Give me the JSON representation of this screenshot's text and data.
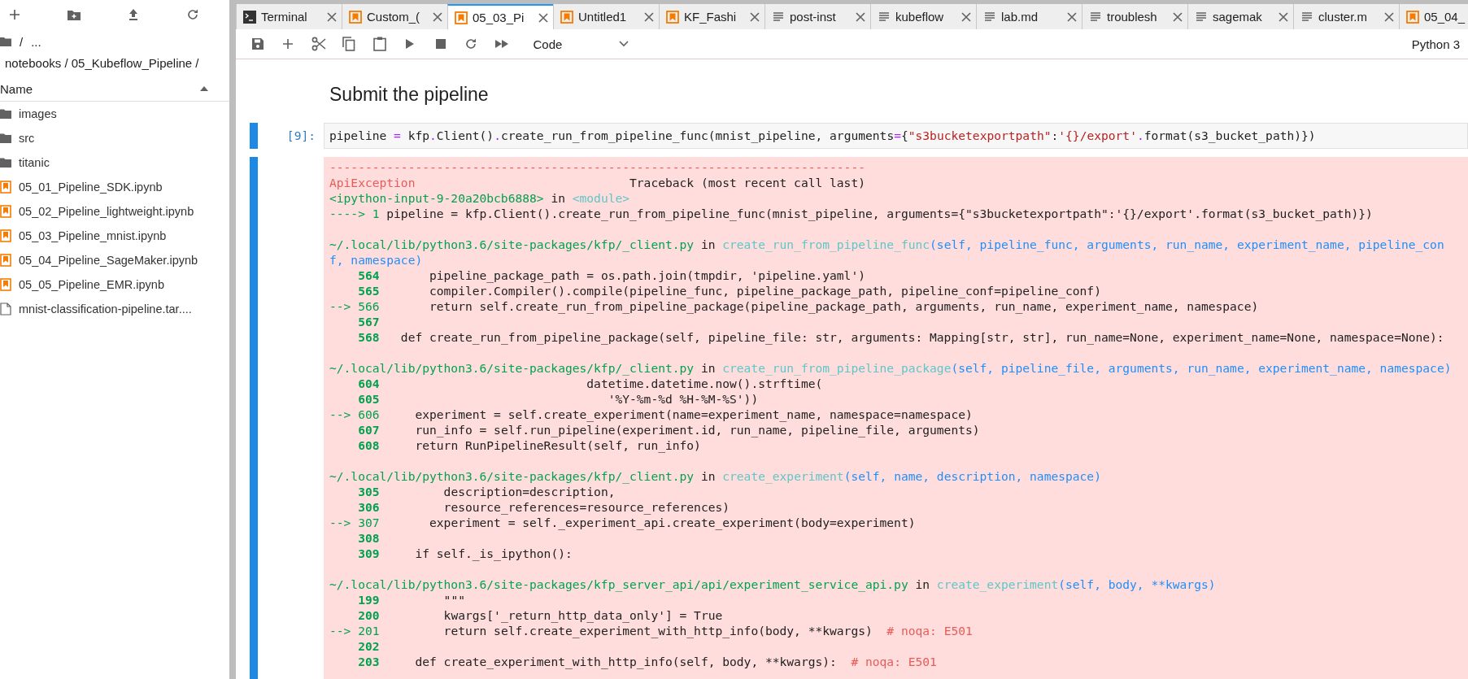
{
  "file_browser": {
    "breadcrumbs": [
      "/",
      "..."
    ],
    "path": "notebooks / 05_Kubeflow_Pipeline /",
    "column_header": "Name",
    "items": [
      {
        "name": "images",
        "kind": "folder"
      },
      {
        "name": "src",
        "kind": "folder"
      },
      {
        "name": "titanic",
        "kind": "folder"
      },
      {
        "name": "05_01_Pipeline_SDK.ipynb",
        "kind": "notebook"
      },
      {
        "name": "05_02_Pipeline_lightweight.ipynb",
        "kind": "notebook"
      },
      {
        "name": "05_03_Pipeline_mnist.ipynb",
        "kind": "notebook"
      },
      {
        "name": "05_04_Pipeline_SageMaker.ipynb",
        "kind": "notebook"
      },
      {
        "name": "05_05_Pipeline_EMR.ipynb",
        "kind": "notebook"
      },
      {
        "name": "mnist-classification-pipeline.tar....",
        "kind": "file"
      }
    ]
  },
  "tabs": [
    {
      "label": "Terminal",
      "kind": "terminal",
      "selected": false
    },
    {
      "label": "Custom_(",
      "kind": "notebook",
      "selected": false
    },
    {
      "label": "05_03_Pi",
      "kind": "notebook",
      "selected": true
    },
    {
      "label": "Untitled1",
      "kind": "notebook",
      "selected": false
    },
    {
      "label": "KF_Fashi",
      "kind": "notebook",
      "selected": false
    },
    {
      "label": "post-inst",
      "kind": "text",
      "selected": false
    },
    {
      "label": "kubeflow",
      "kind": "text",
      "selected": false
    },
    {
      "label": "lab.md",
      "kind": "text",
      "selected": false
    },
    {
      "label": "troublesh",
      "kind": "text",
      "selected": false
    },
    {
      "label": "sagemak",
      "kind": "text",
      "selected": false
    },
    {
      "label": "cluster.m",
      "kind": "text",
      "selected": false
    },
    {
      "label": "05_04_",
      "kind": "notebook",
      "selected": false
    }
  ],
  "notebook_toolbar": {
    "cell_type": "Code",
    "kernel": "Python 3"
  },
  "cells": [
    {
      "kind": "markdown",
      "heading": "Submit the pipeline"
    },
    {
      "kind": "code",
      "prompt": "[9]:",
      "source": [
        {
          "text": "pipeline ",
          "kind": "plain"
        },
        {
          "text": "=",
          "kind": "op"
        },
        {
          "text": " kfp",
          "kind": "plain"
        },
        {
          "text": ".",
          "kind": "op"
        },
        {
          "text": "Client()",
          "kind": "plain"
        },
        {
          "text": ".",
          "kind": "op"
        },
        {
          "text": "create_run_from_pipeline_func(mnist_pipeline, arguments",
          "kind": "plain"
        },
        {
          "text": "=",
          "kind": "op"
        },
        {
          "text": "{",
          "kind": "plain"
        },
        {
          "text": "\"s3bucketexportpath\"",
          "kind": "literal"
        },
        {
          "text": ":",
          "kind": "plain"
        },
        {
          "text": "'{}/export'",
          "kind": "literal"
        },
        {
          "text": ".",
          "kind": "op"
        },
        {
          "text": "format(s3_bucket_path)})",
          "kind": "plain"
        }
      ],
      "output": {
        "kind": "error",
        "blocks": [
          {
            "lines": [
              [
                {
                  "text": "---------------------------------------------------------------------------",
                  "kind": "error"
                }
              ],
              [
                {
                  "text": "ApiException",
                  "kind": "error"
                },
                {
                  "text": "                              Traceback (most recent call last)",
                  "kind": "plain"
                }
              ],
              [
                {
                  "text": "<ipython-input-9-20a20bcb6888>",
                  "kind": "path"
                },
                {
                  "text": " in ",
                  "kind": "plain"
                },
                {
                  "text": "<module>",
                  "kind": "func"
                }
              ],
              [
                {
                  "text": "----> 1 ",
                  "kind": "arrow"
                },
                {
                  "text": "pipeline = kfp.Client().create_run_from_pipeline_func(mnist_pipeline, arguments={\"s3bucketexportpath\":'{}/export'.format(s3_bucket_path)})",
                  "kind": "plain"
                }
              ]
            ]
          },
          {
            "lines": [
              [
                {
                  "text": "~/.local/lib/python3.6/site-packages/kfp/_client.py",
                  "kind": "path"
                },
                {
                  "text": " in ",
                  "kind": "plain"
                },
                {
                  "text": "create_run_from_pipeline_func",
                  "kind": "func"
                },
                {
                  "text": "(self, pipeline_func, arguments, run_name, experiment_name, pipeline_con",
                  "kind": "args"
                }
              ],
              [
                {
                  "text": "f, namespace)",
                  "kind": "args"
                }
              ],
              [
                {
                  "text": "    564",
                  "kind": "lineno"
                },
                {
                  "text": "       pipeline_package_path = os.path.join(tmpdir, 'pipeline.yaml')",
                  "kind": "plain"
                }
              ],
              [
                {
                  "text": "    565",
                  "kind": "lineno"
                },
                {
                  "text": "       compiler.Compiler().compile(pipeline_func, pipeline_package_path, pipeline_conf=pipeline_conf)",
                  "kind": "plain"
                }
              ],
              [
                {
                  "text": "--> 566",
                  "kind": "arrow"
                },
                {
                  "text": "       return self.create_run_from_pipeline_package(pipeline_package_path, arguments, run_name, experiment_name, namespace)",
                  "kind": "plain"
                }
              ],
              [
                {
                  "text": "    567",
                  "kind": "lineno"
                }
              ],
              [
                {
                  "text": "    568",
                  "kind": "lineno"
                },
                {
                  "text": "   def create_run_from_pipeline_package(self, pipeline_file: str, arguments: Mapping[str, str], run_name=None, experiment_name=None, namespace=None):",
                  "kind": "plain"
                }
              ]
            ]
          },
          {
            "lines": [
              [
                {
                  "text": "~/.local/lib/python3.6/site-packages/kfp/_client.py",
                  "kind": "path"
                },
                {
                  "text": " in ",
                  "kind": "plain"
                },
                {
                  "text": "create_run_from_pipeline_package",
                  "kind": "func"
                },
                {
                  "text": "(self, pipeline_file, arguments, run_name, experiment_name, namespace)",
                  "kind": "args"
                }
              ],
              [
                {
                  "text": "    604",
                  "kind": "lineno"
                },
                {
                  "text": "                             datetime.datetime.now().strftime(",
                  "kind": "plain"
                }
              ],
              [
                {
                  "text": "    605",
                  "kind": "lineno"
                },
                {
                  "text": "                                '%Y-%m-%d %H-%M-%S'))",
                  "kind": "plain"
                }
              ],
              [
                {
                  "text": "--> 606",
                  "kind": "arrow"
                },
                {
                  "text": "     experiment = self.create_experiment(name=experiment_name, namespace=namespace)",
                  "kind": "plain"
                }
              ],
              [
                {
                  "text": "    607",
                  "kind": "lineno"
                },
                {
                  "text": "     run_info = self.run_pipeline(experiment.id, run_name, pipeline_file, arguments)",
                  "kind": "plain"
                }
              ],
              [
                {
                  "text": "    608",
                  "kind": "lineno"
                },
                {
                  "text": "     return RunPipelineResult(self, run_info)",
                  "kind": "plain"
                }
              ]
            ]
          },
          {
            "lines": [
              [
                {
                  "text": "~/.local/lib/python3.6/site-packages/kfp/_client.py",
                  "kind": "path"
                },
                {
                  "text": " in ",
                  "kind": "plain"
                },
                {
                  "text": "create_experiment",
                  "kind": "func"
                },
                {
                  "text": "(self, name, description, namespace)",
                  "kind": "args"
                }
              ],
              [
                {
                  "text": "    305",
                  "kind": "lineno"
                },
                {
                  "text": "         description=description,",
                  "kind": "plain"
                }
              ],
              [
                {
                  "text": "    306",
                  "kind": "lineno"
                },
                {
                  "text": "         resource_references=resource_references)",
                  "kind": "plain"
                }
              ],
              [
                {
                  "text": "--> 307",
                  "kind": "arrow"
                },
                {
                  "text": "       experiment = self._experiment_api.create_experiment(body=experiment)",
                  "kind": "plain"
                }
              ],
              [
                {
                  "text": "    308",
                  "kind": "lineno"
                }
              ],
              [
                {
                  "text": "    309",
                  "kind": "lineno"
                },
                {
                  "text": "     if self._is_ipython():",
                  "kind": "plain"
                }
              ]
            ]
          },
          {
            "lines": [
              [
                {
                  "text": "~/.local/lib/python3.6/site-packages/kfp_server_api/api/experiment_service_api.py",
                  "kind": "path"
                },
                {
                  "text": " in ",
                  "kind": "plain"
                },
                {
                  "text": "create_experiment",
                  "kind": "func"
                },
                {
                  "text": "(self, body, **kwargs)",
                  "kind": "args"
                }
              ],
              [
                {
                  "text": "    199",
                  "kind": "lineno"
                },
                {
                  "text": "         \"\"\"",
                  "kind": "plain"
                }
              ],
              [
                {
                  "text": "    200",
                  "kind": "lineno"
                },
                {
                  "text": "         kwargs['_return_http_data_only'] = True",
                  "kind": "plain"
                }
              ],
              [
                {
                  "text": "--> 201",
                  "kind": "arrow"
                },
                {
                  "text": "         return self.create_experiment_with_http_info(body, **kwargs)",
                  "kind": "plain"
                },
                {
                  "text": "  # noqa: E501",
                  "kind": "comment"
                }
              ],
              [
                {
                  "text": "    202",
                  "kind": "lineno"
                }
              ],
              [
                {
                  "text": "    203",
                  "kind": "lineno"
                },
                {
                  "text": "     def create_experiment_with_http_info(self, body, **kwargs):",
                  "kind": "plain"
                },
                {
                  "text": "  # noqa: E501",
                  "kind": "comment"
                }
              ]
            ]
          }
        ]
      }
    }
  ]
}
